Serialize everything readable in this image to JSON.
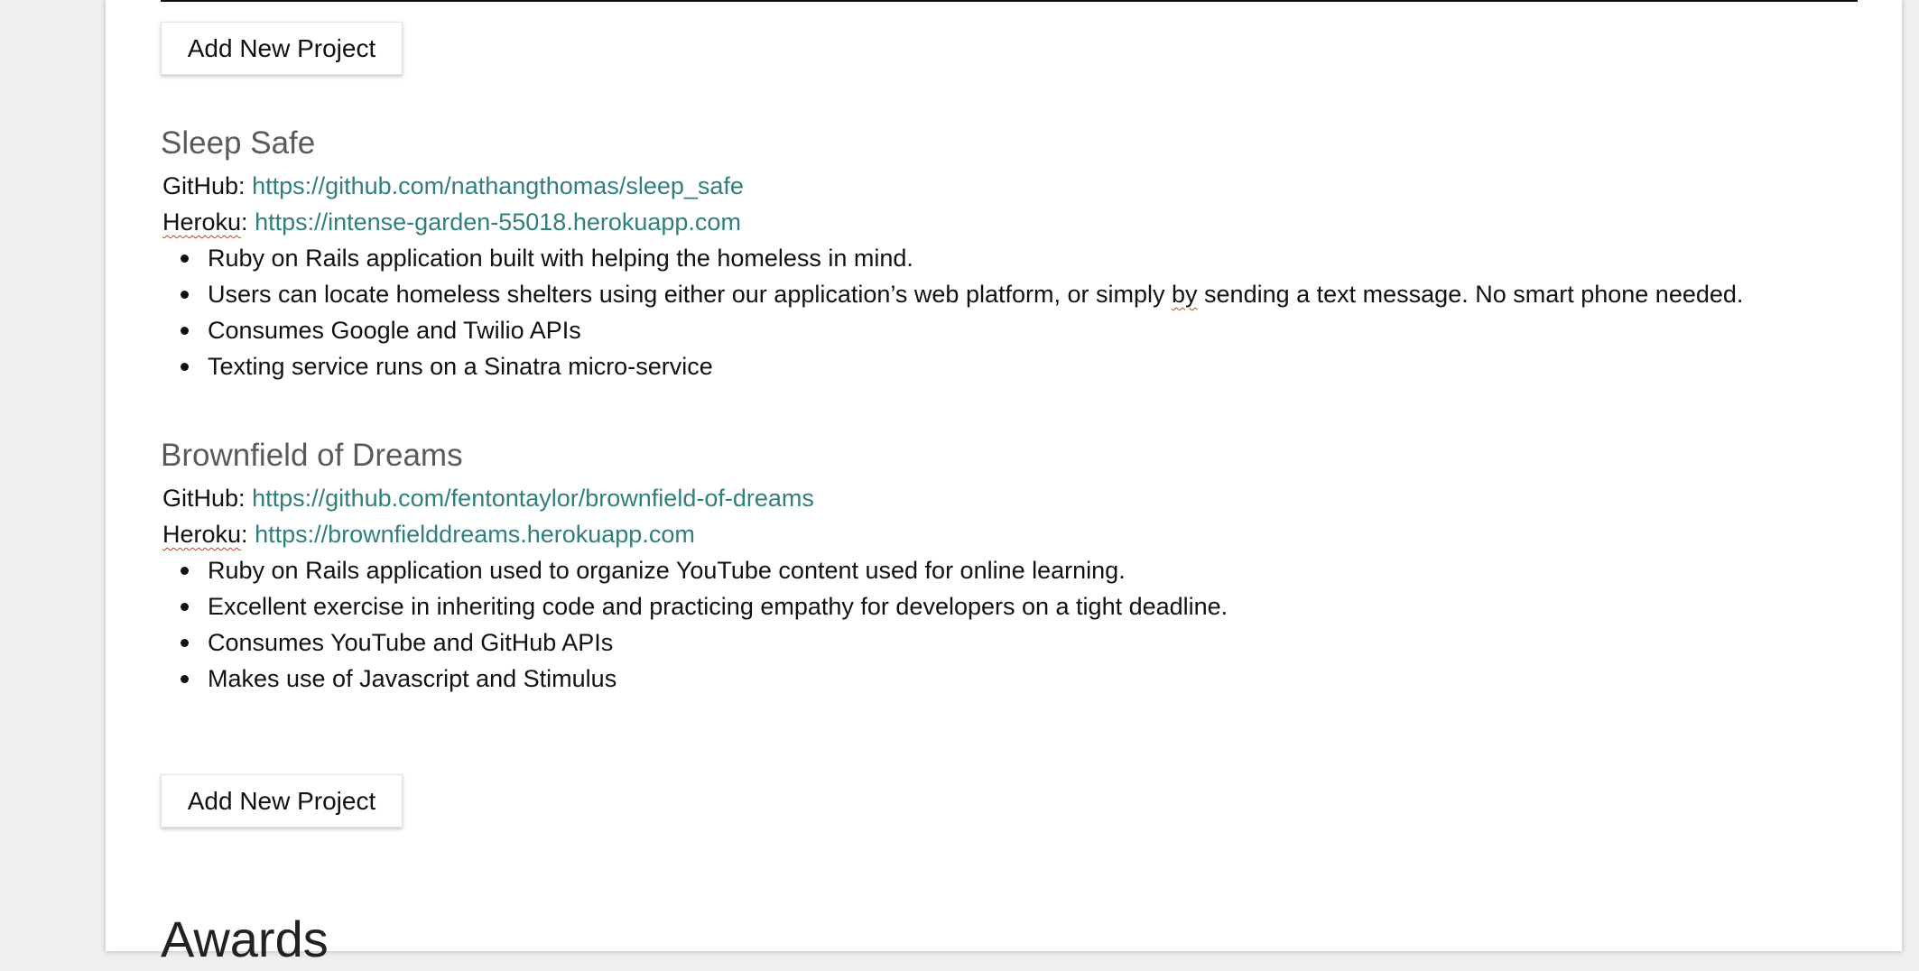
{
  "buttons": {
    "add_project_top": "Add New Project",
    "add_project_bottom": "Add New Project"
  },
  "projects": [
    {
      "title": "Sleep Safe",
      "github_label": "GitHub:",
      "github_url": "https://github.com/nathangthomas/sleep_safe",
      "heroku_label": "Heroku",
      "heroku_colon": ":",
      "heroku_url": "https://intense-garden-55018.herokuapp.com",
      "bullets": [
        "Ruby on Rails application built with helping the homeless in mind.",
        "Users can locate homeless shelters using either our application’s web platform, or simply ",
        "Consumes Google and Twilio APIs",
        "Texting service runs on a Sinatra micro-service"
      ],
      "bullet_2_misspelled": "by",
      "bullet_2_tail": " sending a text message. No smart phone needed."
    },
    {
      "title": "Brownfield of Dreams",
      "github_label": "GitHub:",
      "github_url": "https://github.com/fentontaylor/brownfield-of-dreams",
      "heroku_label": "Heroku",
      "heroku_colon": ":",
      "heroku_url": "https://brownfielddreams.herokuapp.com",
      "bullets": [
        "Ruby on Rails application used to organize YouTube content used for online learning.",
        "Excellent exercise in inheriting code and practicing empathy for developers on a tight deadline.",
        "Consumes YouTube and GitHub APIs",
        "Makes use of Javascript and Stimulus"
      ]
    }
  ],
  "awards_heading": "Awards",
  "colors": {
    "link": "#2f7f7c",
    "title": "#5a5a5a",
    "background": "#efefef"
  }
}
